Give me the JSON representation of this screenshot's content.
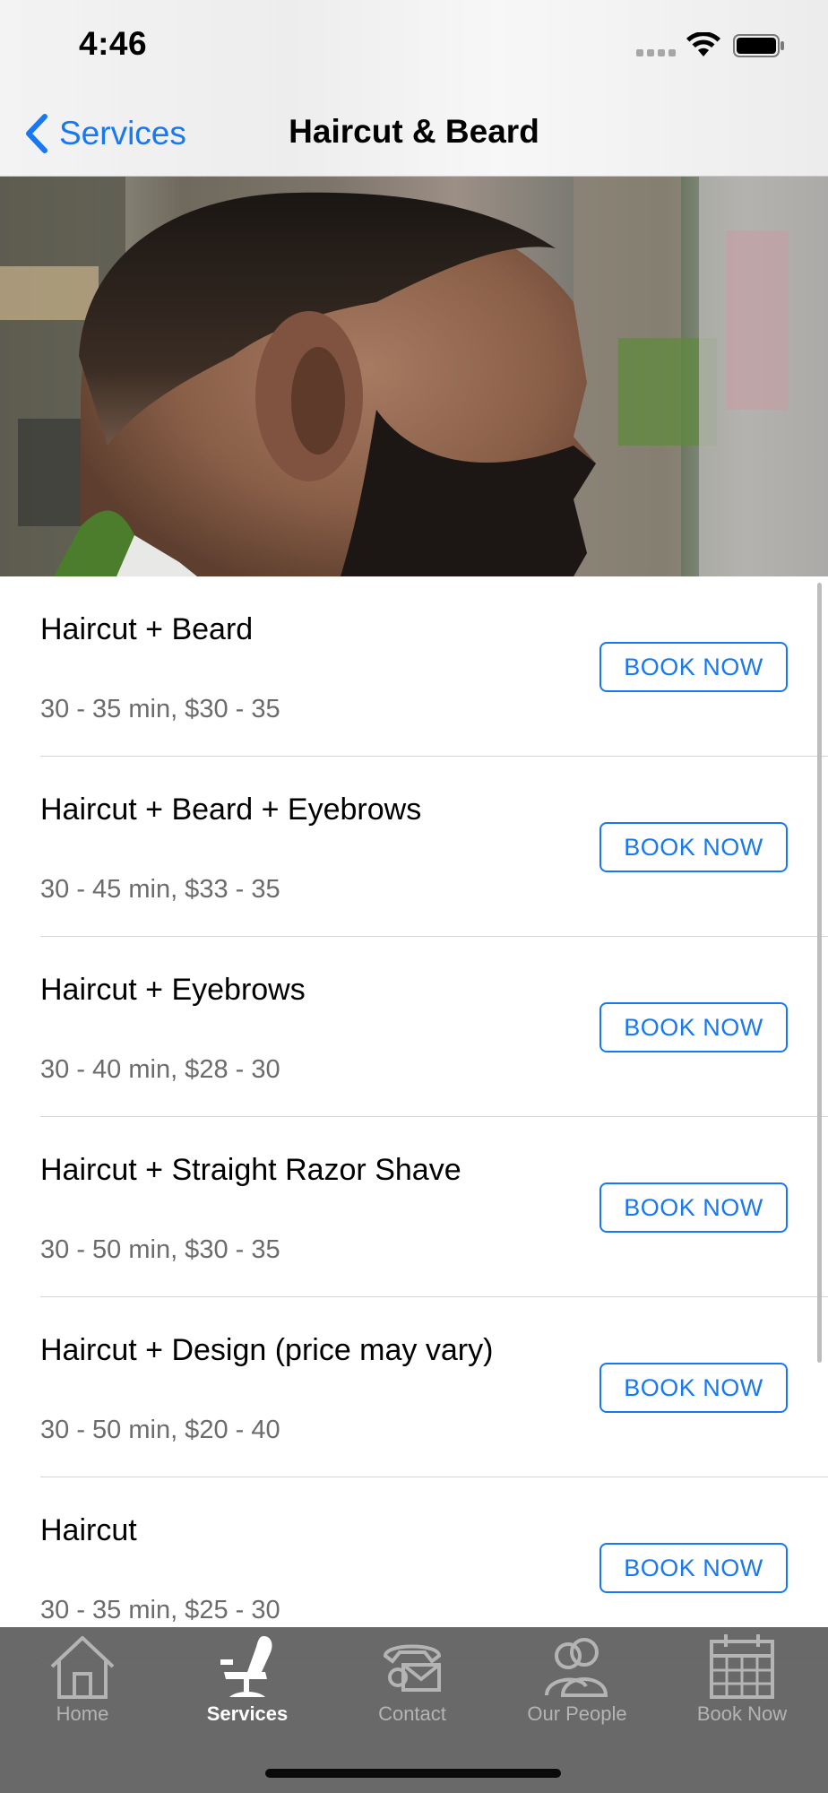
{
  "status_bar": {
    "time": "4:46"
  },
  "nav": {
    "back_label": "Services",
    "title": "Haircut & Beard"
  },
  "colors": {
    "accent": "#1778f2",
    "meta_text": "#6b6b6b",
    "tab_bar": "#606060"
  },
  "services": [
    {
      "name": "Haircut + Beard",
      "meta": "30 - 35 min, $30 - 35",
      "button": "BOOK NOW"
    },
    {
      "name": "Haircut + Beard + Eyebrows",
      "meta": "30 - 45 min, $33 - 35",
      "button": "BOOK NOW"
    },
    {
      "name": "Haircut + Eyebrows",
      "meta": "30 - 40 min, $28 - 30",
      "button": "BOOK NOW"
    },
    {
      "name": "Haircut + Straight Razor Shave",
      "meta": "30 - 50 min, $30 - 35",
      "button": "BOOK NOW"
    },
    {
      "name": "Haircut + Design (price may vary)",
      "meta": "30 - 50 min, $20 - 40",
      "button": "BOOK NOW"
    },
    {
      "name": "Haircut",
      "meta": "30 - 35 min, $25 - 30",
      "button": "BOOK NOW"
    }
  ],
  "tabs": [
    {
      "label": "Home",
      "icon": "home-icon"
    },
    {
      "label": "Services",
      "icon": "barber-chair-icon",
      "active": true
    },
    {
      "label": "Contact",
      "icon": "phone-mail-icon"
    },
    {
      "label": "Our People",
      "icon": "people-icon"
    },
    {
      "label": "Book Now",
      "icon": "calendar-icon"
    }
  ]
}
